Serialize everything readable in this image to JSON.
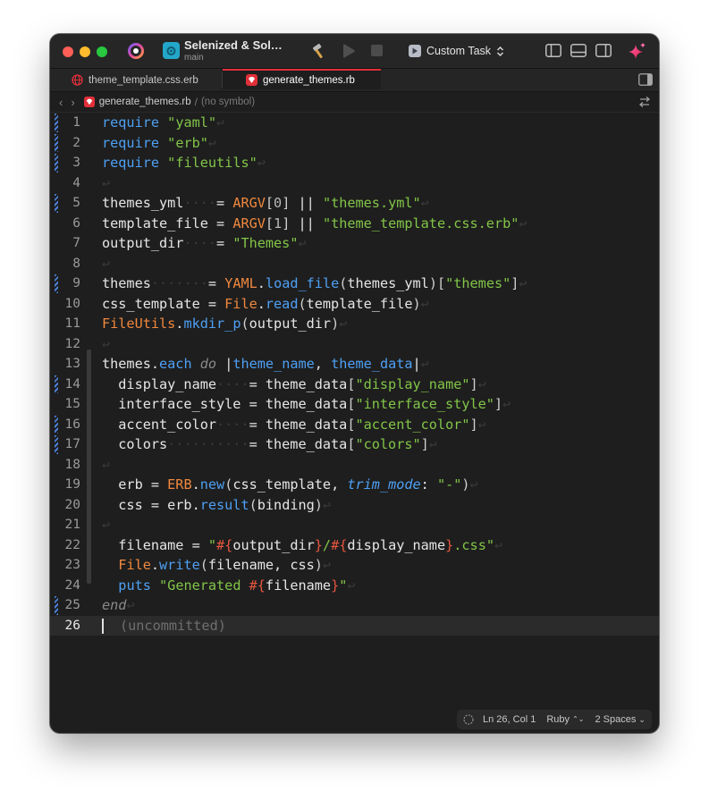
{
  "titlebar": {
    "project_title": "Selenized & Sol…",
    "branch": "main",
    "scheme_label": "Custom Task"
  },
  "tabs": [
    {
      "label": "theme_template.css.erb",
      "active": false
    },
    {
      "label": "generate_themes.rb",
      "active": true
    }
  ],
  "jumpbar": {
    "back": "‹",
    "forward": "›",
    "file": "generate_themes.rb",
    "separator": "/",
    "symbol": "(no symbol)"
  },
  "editor": {
    "language": "Ruby",
    "current_line": 26,
    "uncommitted_label": "(uncommitted)",
    "lines": [
      {
        "n": "1",
        "text": "require \"yaml\"",
        "changed": true
      },
      {
        "n": "2",
        "text": "require \"erb\"",
        "changed": true
      },
      {
        "n": "3",
        "text": "require \"fileutils\"",
        "changed": true
      },
      {
        "n": "4",
        "text": "",
        "changed": false
      },
      {
        "n": "5",
        "text": "themes_yml    = ARGV[0] || \"themes.yml\"",
        "changed": true
      },
      {
        "n": "6",
        "text": "template_file = ARGV[1] || \"theme_template.css.erb\"",
        "changed": false
      },
      {
        "n": "7",
        "text": "output_dir    = \"Themes\"",
        "changed": false
      },
      {
        "n": "8",
        "text": "",
        "changed": false
      },
      {
        "n": "9",
        "text": "themes       = YAML.load_file(themes_yml)[\"themes\"]",
        "changed": true
      },
      {
        "n": "10",
        "text": "css_template = File.read(template_file)",
        "changed": false
      },
      {
        "n": "11",
        "text": "FileUtils.mkdir_p(output_dir)",
        "changed": false
      },
      {
        "n": "12",
        "text": "",
        "changed": false
      },
      {
        "n": "13",
        "text": "themes.each do |theme_name, theme_data|",
        "changed": false
      },
      {
        "n": "14",
        "text": "  display_name    = theme_data[\"display_name\"]",
        "changed": true
      },
      {
        "n": "15",
        "text": "  interface_style = theme_data[\"interface_style\"]",
        "changed": false
      },
      {
        "n": "16",
        "text": "  accent_color    = theme_data[\"accent_color\"]",
        "changed": true
      },
      {
        "n": "17",
        "text": "  colors          = theme_data[\"colors\"]",
        "changed": true
      },
      {
        "n": "18",
        "text": "",
        "changed": false
      },
      {
        "n": "19",
        "text": "  erb = ERB.new(css_template, trim_mode: \"-\")",
        "changed": false
      },
      {
        "n": "20",
        "text": "  css = erb.result(binding)",
        "changed": false
      },
      {
        "n": "21",
        "text": "",
        "changed": false
      },
      {
        "n": "22",
        "text": "  filename = \"#{output_dir}/#{display_name}.css\"",
        "changed": false
      },
      {
        "n": "23",
        "text": "  File.write(filename, css)",
        "changed": false
      },
      {
        "n": "24",
        "text": "  puts \"Generated #{filename}\"",
        "changed": false
      },
      {
        "n": "25",
        "text": "end",
        "changed": true
      },
      {
        "n": "26",
        "text": "",
        "changed": false
      }
    ]
  },
  "statusbar": {
    "position": "Ln 26, Col 1",
    "language": "Ruby",
    "language_chevron": "⌃⌄",
    "indent": "2 Spaces"
  },
  "icons": {
    "xcode": "xcode-logo-icon",
    "project": "project-icon",
    "build": "hammer-icon",
    "run": "play-icon",
    "stop": "stop-icon",
    "scheme": "scheme-icon",
    "navigator": "navigator-toggle-icon",
    "debug_area": "debug-area-toggle-icon",
    "inspector": "inspector-toggle-icon",
    "assistant": "sparkle-icon",
    "ruby": "ruby-file-icon"
  },
  "colors": {
    "accent": "#e0303a",
    "keyword": "#4ea0f4",
    "string": "#82c548",
    "constant": "#f0883e",
    "interpolation": "#e6573f",
    "change_marker": "#4a7fd8"
  }
}
